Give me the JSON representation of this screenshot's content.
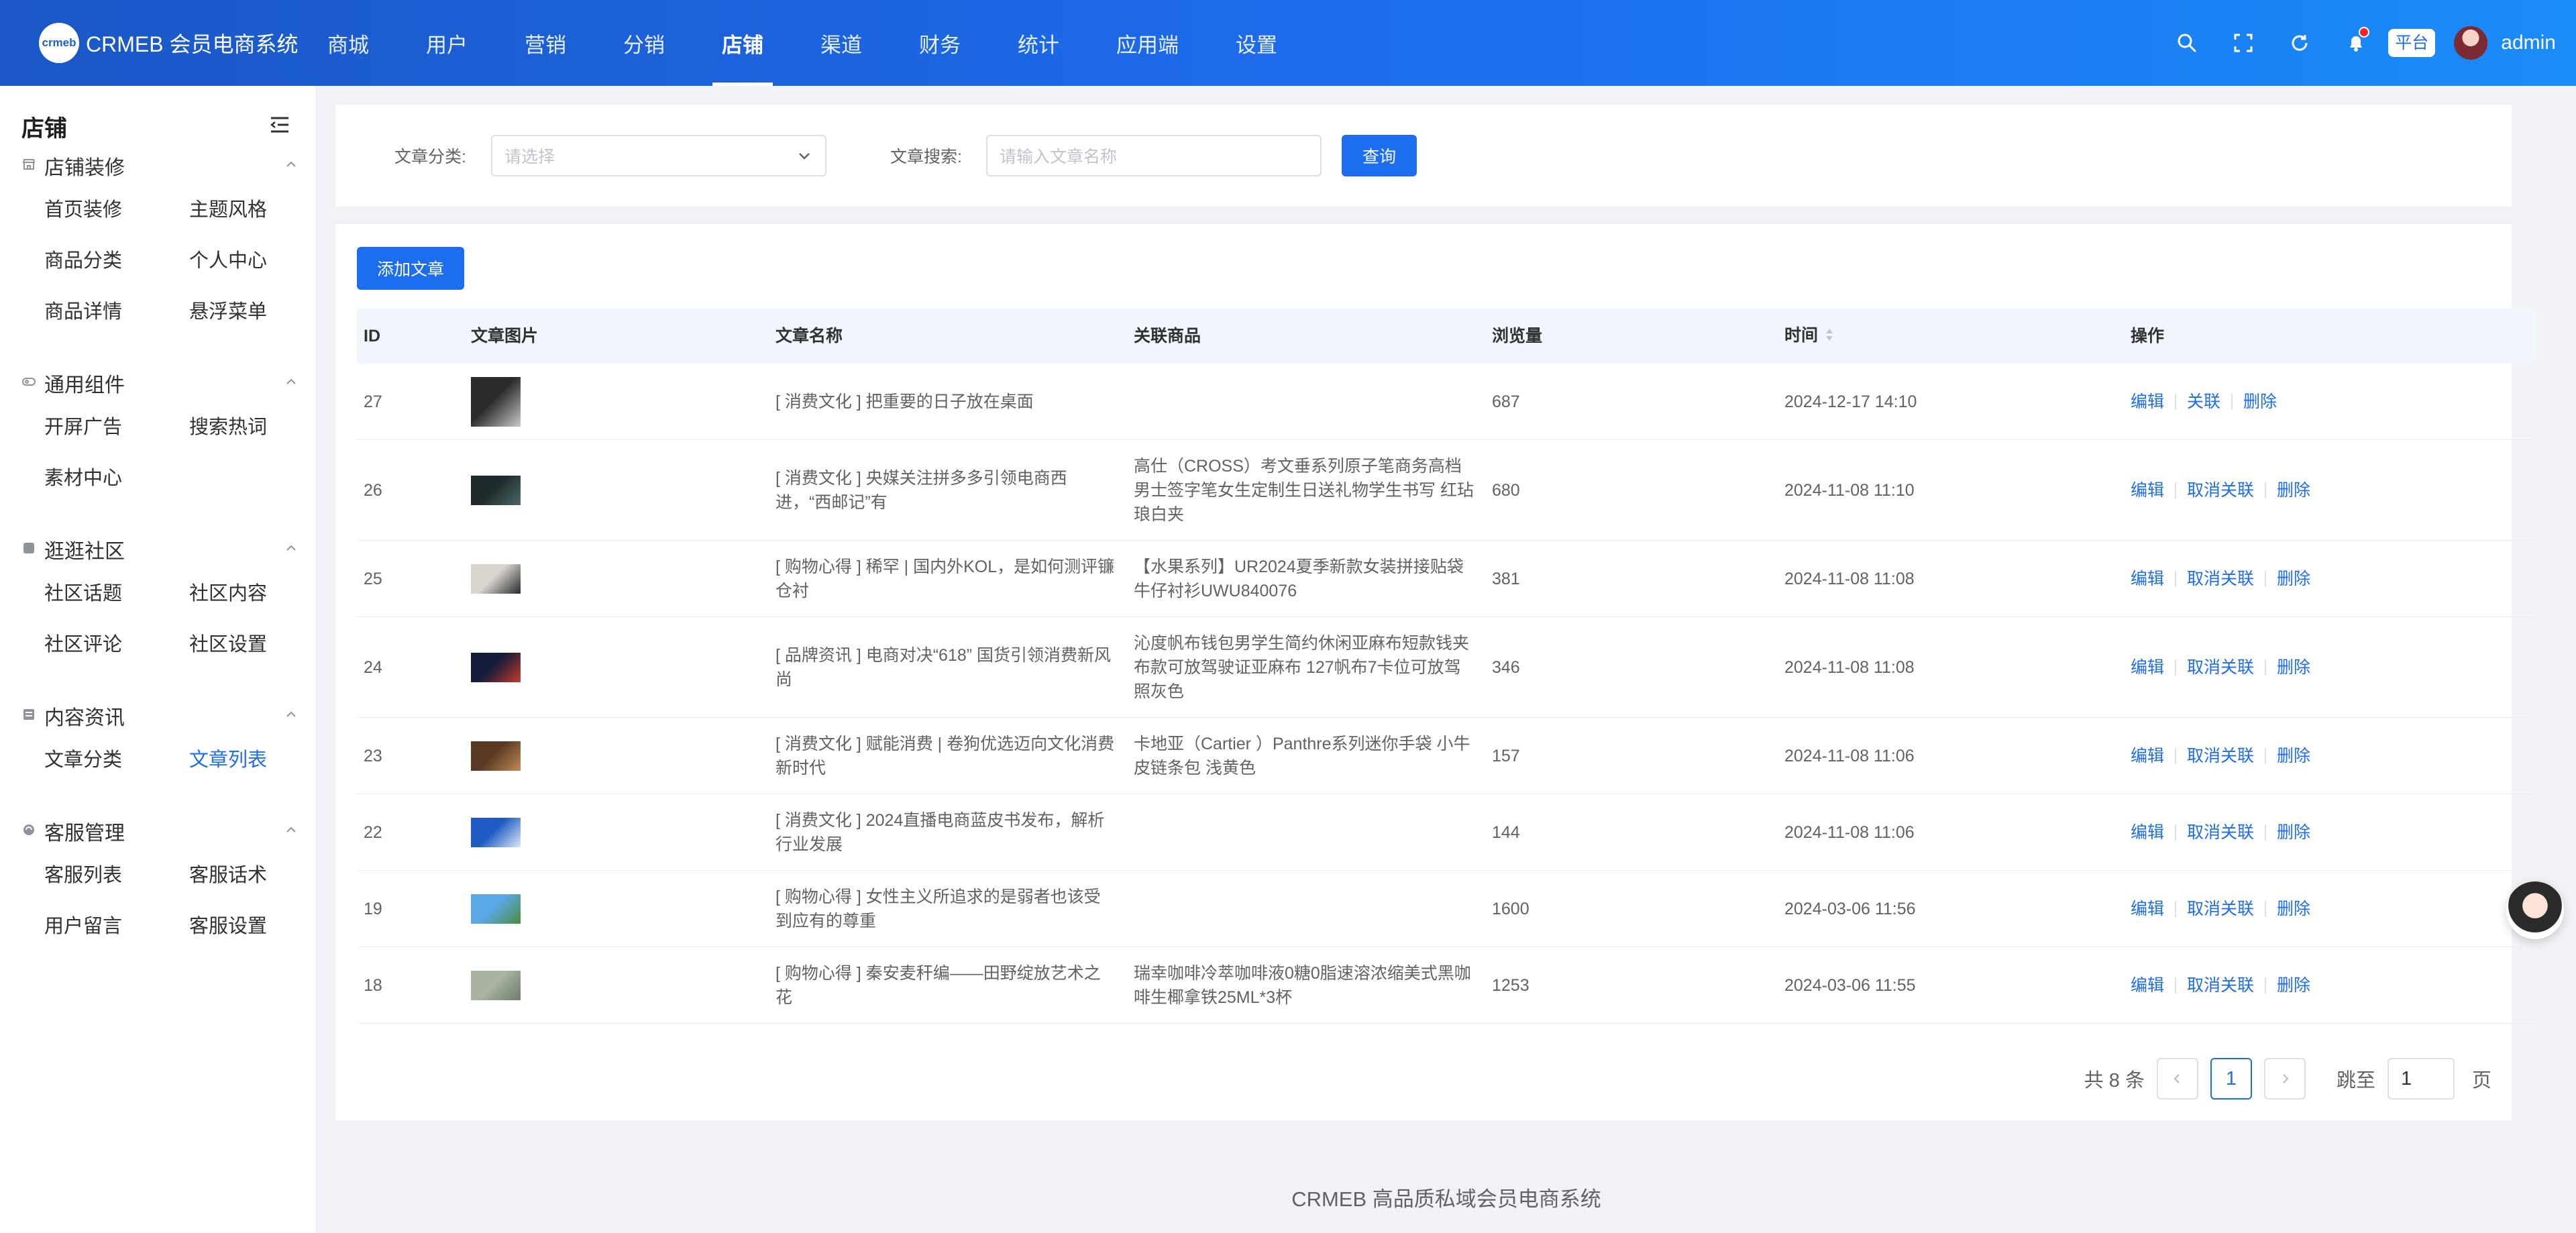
{
  "brand": {
    "logo_mark": "crmeb",
    "name": "CRMEB 会员电商系统"
  },
  "nav": [
    "商城",
    "用户",
    "营销",
    "分销",
    "店铺",
    "渠道",
    "财务",
    "统计",
    "应用端",
    "设置"
  ],
  "nav_active": "店铺",
  "header": {
    "platform_badge": "平台",
    "username": "admin"
  },
  "sidebar": {
    "title": "店铺",
    "groups": [
      {
        "title": "店铺装修",
        "icon": "store-icon",
        "items": [
          "首页装修",
          "主题风格",
          "商品分类",
          "个人中心",
          "商品详情",
          "悬浮菜单"
        ]
      },
      {
        "title": "通用组件",
        "icon": "component-icon",
        "items": [
          "开屏广告",
          "搜索热词",
          "素材中心"
        ]
      },
      {
        "title": "逛逛社区",
        "icon": "community-icon",
        "items": [
          "社区话题",
          "社区内容",
          "社区评论",
          "社区设置"
        ]
      },
      {
        "title": "内容资讯",
        "icon": "news-icon",
        "items": [
          "文章分类",
          "文章列表"
        ]
      },
      {
        "title": "客服管理",
        "icon": "service-icon",
        "items": [
          "客服列表",
          "客服话术",
          "用户留言",
          "客服设置"
        ]
      }
    ],
    "active_item": "文章列表"
  },
  "filter": {
    "category_label": "文章分类:",
    "category_placeholder": "请选择",
    "search_label": "文章搜索:",
    "search_placeholder": "请输入文章名称",
    "query_button": "查询"
  },
  "actions": {
    "add_button": "添加文章"
  },
  "table": {
    "columns": [
      "ID",
      "文章图片",
      "文章名称",
      "关联商品",
      "浏览量",
      "时间",
      "操作"
    ],
    "rows": [
      {
        "id": "27",
        "name": "[ 消费文化 ] 把重要的日子放在桌面",
        "goods": "",
        "views": "687",
        "time": "2024-12-17 14:10",
        "ops": [
          "编辑",
          "关联",
          "删除"
        ],
        "thumb_colors": [
          "#2a2a2a",
          "#c9c9c9"
        ]
      },
      {
        "id": "26",
        "name": "[ 消费文化 ] 央媒关注拼多多引领电商西进，“西邮记”有",
        "goods": "高仕（CROSS）考文垂系列原子笔商务高档男士签字笔女生定制生日送礼物学生书写 红玷琅白夹",
        "views": "680",
        "time": "2024-11-08 11:10",
        "ops": [
          "编辑",
          "取消关联",
          "删除"
        ],
        "thumb_colors": [
          "#1f2a2c",
          "#4a6b6a"
        ]
      },
      {
        "id": "25",
        "name": "[ 购物心得 ] 稀罕 | 国内外KOL，是如何测评镰仓衬",
        "goods": "【水果系列】UR2024夏季新款女装拼接贴袋牛仔衬衫UWU840076",
        "views": "381",
        "time": "2024-11-08 11:08",
        "ops": [
          "编辑",
          "取消关联",
          "删除"
        ],
        "thumb_colors": [
          "#d8d4ce",
          "#2b2b2b"
        ]
      },
      {
        "id": "24",
        "name": "[ 品牌资讯 ] 电商对决“618” 国货引领消费新风尚",
        "goods": "沁度帆布钱包男学生简约休闲亚麻布短款钱夹布款可放驾驶证亚麻布 127帆布7卡位可放驾照灰色",
        "views": "346",
        "time": "2024-11-08 11:08",
        "ops": [
          "编辑",
          "取消关联",
          "删除"
        ],
        "thumb_colors": [
          "#141c3a",
          "#c73b2e"
        ]
      },
      {
        "id": "23",
        "name": "[ 消费文化 ] 赋能消费 | 卷狗优选迈向文化消费新时代",
        "goods": "卡地亚（Cartier ）Panthre系列迷你手袋 小牛皮链条包 浅黄色",
        "views": "157",
        "time": "2024-11-08 11:06",
        "ops": [
          "编辑",
          "取消关联",
          "删除"
        ],
        "thumb_colors": [
          "#5a3a22",
          "#c08a55"
        ]
      },
      {
        "id": "22",
        "name": "[ 消费文化 ] 2024直播电商蓝皮书发布，解析行业发展",
        "goods": "",
        "views": "144",
        "time": "2024-11-08 11:06",
        "ops": [
          "编辑",
          "取消关联",
          "删除"
        ],
        "thumb_colors": [
          "#1e5bc2",
          "#dfe8f6"
        ]
      },
      {
        "id": "19",
        "name": "[ 购物心得 ] 女性主义所追求的是弱者也该受到应有的尊重",
        "goods": "",
        "views": "1600",
        "time": "2024-03-06 11:56",
        "ops": [
          "编辑",
          "取消关联",
          "删除"
        ],
        "thumb_colors": [
          "#5aa9e6",
          "#4e8a3a"
        ]
      },
      {
        "id": "18",
        "name": "[ 购物心得 ] 秦安麦秆编——田野绽放艺术之花",
        "goods": "瑞幸咖啡冷萃咖啡液0糖0脂速溶浓缩美式黑咖啡生椰拿铁25ML*3杯",
        "views": "1253",
        "time": "2024-03-06 11:55",
        "ops": [
          "编辑",
          "取消关联",
          "删除"
        ],
        "thumb_colors": [
          "#a9b3a0",
          "#6f7d6a"
        ]
      }
    ]
  },
  "pagination": {
    "total_text": "共 8 条",
    "current_page": "1",
    "jump_label": "跳至",
    "jump_value": "1",
    "page_suffix": "页"
  },
  "footer": "CRMEB 高品质私域会员电商系统",
  "colors": {
    "primary": "#1d6df0",
    "header_gradient_start": "#1b57c6",
    "header_gradient_end": "#1a8cf7"
  }
}
